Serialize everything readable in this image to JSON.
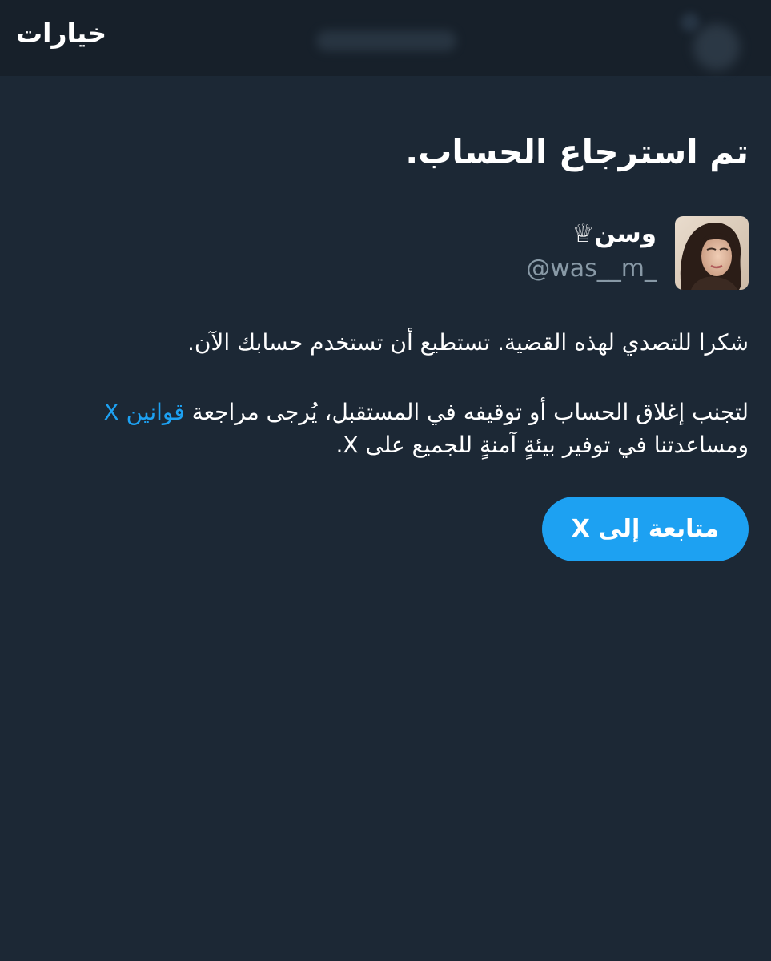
{
  "header": {
    "options_label": "خيارات"
  },
  "main": {
    "title": "تم استرجاع الحساب.",
    "profile": {
      "display_name": "وسن♕",
      "handle": "@was__m_"
    },
    "paragraph1": "شكرا للتصدي لهذه القضية. تستطيع أن تستخدم حسابك الآن.",
    "paragraph2": {
      "before_link": "لتجنب إغلاق الحساب أو توقيفه في المستقبل، يُرجى مراجعة ",
      "link": "قوانين X",
      "after_link": " ومساعدتنا في توفير بيئةٍ آمنةٍ للجميع على X."
    },
    "continue_label": "متابعة إلى X"
  },
  "colors": {
    "background": "#1c2835",
    "header_background": "#17202a",
    "accent": "#1da1f2",
    "secondary_text": "#8899a6"
  }
}
